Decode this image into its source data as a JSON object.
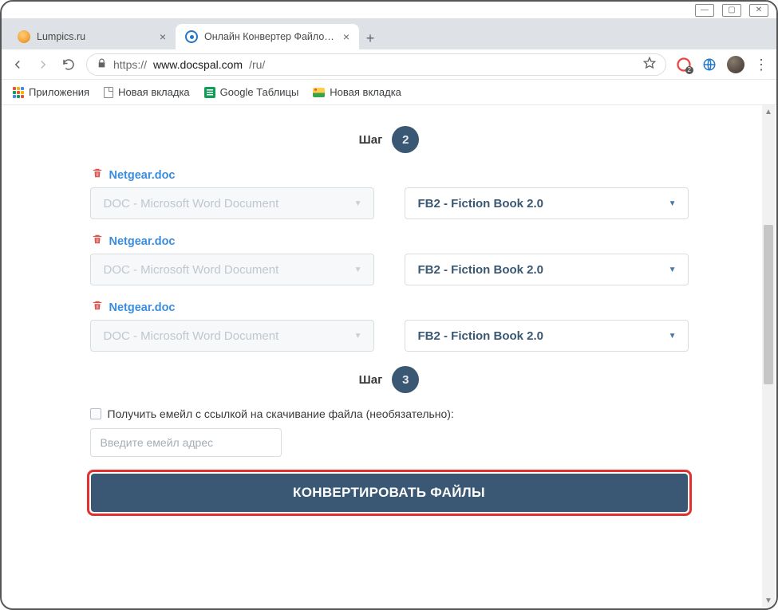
{
  "window": {
    "minimize": "—",
    "maximize": "▢",
    "close": "✕"
  },
  "tabs": [
    {
      "title": "Lumpics.ru",
      "favicon": "orange",
      "active": false
    },
    {
      "title": "Онлайн Конвертер Файлов - Dc",
      "favicon": "blue",
      "active": true
    }
  ],
  "address": {
    "secure_prefix": "https://",
    "host": "www.docspal.com",
    "path": "/ru/"
  },
  "bookmarks": {
    "apps": "Приложения",
    "newtab1": "Новая вкладка",
    "sheets": "Google Таблицы",
    "newtab2": "Новая вкладка"
  },
  "extension_badge": "2",
  "step2": {
    "label": "Шаг",
    "num": "2"
  },
  "files": [
    {
      "name": "Netgear.doc",
      "source": "DOC - Microsoft Word Document",
      "target": "FB2 - Fiction Book 2.0"
    },
    {
      "name": "Netgear.doc",
      "source": "DOC - Microsoft Word Document",
      "target": "FB2 - Fiction Book 2.0"
    },
    {
      "name": "Netgear.doc",
      "source": "DOC - Microsoft Word Document",
      "target": "FB2 - Fiction Book 2.0"
    }
  ],
  "step3": {
    "label": "Шаг",
    "num": "3"
  },
  "email_checkbox_label": "Получить емейл с ссылкой на скачивание файла (необязательно):",
  "email_placeholder": "Введите емейл адрес",
  "convert_button": "КОНВЕРТИРОВАТЬ ФАЙЛЫ"
}
